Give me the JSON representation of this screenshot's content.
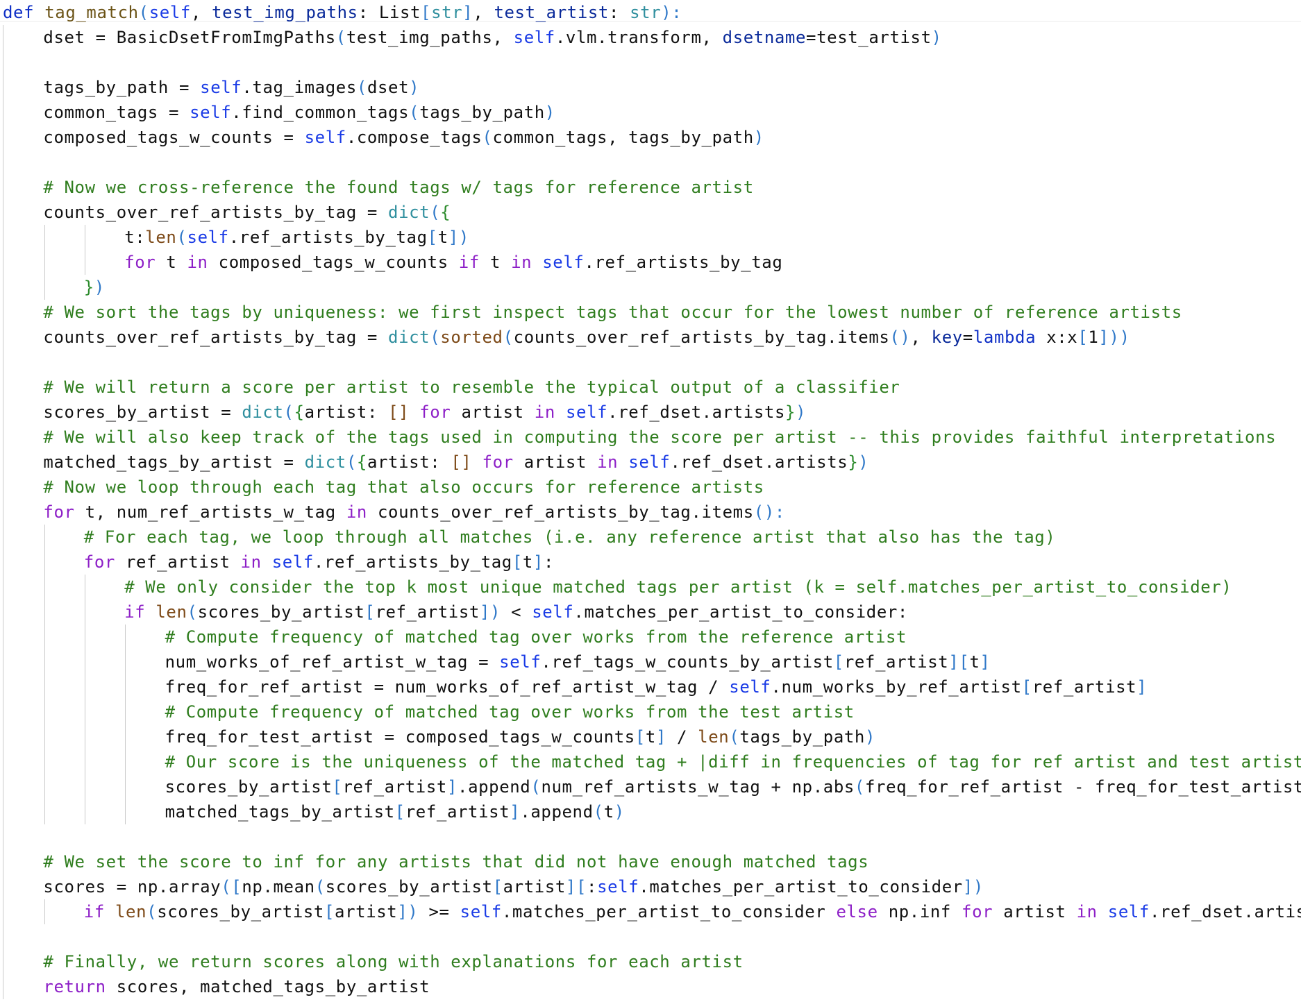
{
  "editor": {
    "language": "python",
    "colors": {
      "background": "#ffffff",
      "default": "#111111",
      "keyword": "#8d1fc7",
      "def_keyword": "#0f2fc6",
      "function_name": "#6b5316",
      "self": "#1a3be6",
      "builtin": "#7d4a18",
      "type": "#2f8f9e",
      "param": "#0a2a9a",
      "comment": "#2f7d1e",
      "bracket": "#2f78c8",
      "brace": "#2a8a2a"
    },
    "lines": [
      {
        "indent": 0,
        "tokens": [
          [
            "def",
            "def_keyword"
          ],
          [
            " ",
            ""
          ],
          [
            "tag_match",
            "function_name"
          ],
          [
            "(",
            "bracket"
          ],
          [
            "self",
            "self"
          ],
          [
            ", ",
            ""
          ],
          [
            "test_img_paths",
            "param"
          ],
          [
            ": List",
            ""
          ],
          [
            "[",
            "bracket"
          ],
          [
            "str",
            "type"
          ],
          [
            "]",
            "bracket"
          ],
          [
            ", ",
            ""
          ],
          [
            "test_artist",
            "param"
          ],
          [
            ": ",
            ""
          ],
          [
            "str",
            "type"
          ],
          [
            "):",
            "bracket"
          ]
        ]
      },
      {
        "indent": 1,
        "tokens": [
          [
            "dset = BasicDsetFromImgPaths",
            ""
          ],
          [
            "(",
            "bracket"
          ],
          [
            "test_img_paths, ",
            ""
          ],
          [
            "self",
            "self"
          ],
          [
            ".vlm.transform, ",
            ""
          ],
          [
            "dsetname",
            "param"
          ],
          [
            "=test_artist",
            ""
          ],
          [
            ")",
            "bracket"
          ]
        ]
      },
      {
        "indent": 1,
        "tokens": []
      },
      {
        "indent": 1,
        "tokens": [
          [
            "tags_by_path = ",
            ""
          ],
          [
            "self",
            "self"
          ],
          [
            ".tag_images",
            ""
          ],
          [
            "(",
            "bracket"
          ],
          [
            "dset",
            ""
          ],
          [
            ")",
            "bracket"
          ]
        ]
      },
      {
        "indent": 1,
        "tokens": [
          [
            "common_tags = ",
            ""
          ],
          [
            "self",
            "self"
          ],
          [
            ".find_common_tags",
            ""
          ],
          [
            "(",
            "bracket"
          ],
          [
            "tags_by_path",
            ""
          ],
          [
            ")",
            "bracket"
          ]
        ]
      },
      {
        "indent": 1,
        "tokens": [
          [
            "composed_tags_w_counts = ",
            ""
          ],
          [
            "self",
            "self"
          ],
          [
            ".compose_tags",
            ""
          ],
          [
            "(",
            "bracket"
          ],
          [
            "common_tags, tags_by_path",
            ""
          ],
          [
            ")",
            "bracket"
          ]
        ]
      },
      {
        "indent": 1,
        "tokens": []
      },
      {
        "indent": 1,
        "tokens": [
          [
            "# Now we cross-reference the found tags w/ tags for reference artist",
            "comment"
          ]
        ]
      },
      {
        "indent": 1,
        "tokens": [
          [
            "counts_over_ref_artists_by_tag = ",
            ""
          ],
          [
            "dict",
            "type"
          ],
          [
            "(",
            "bracket"
          ],
          [
            "{",
            "brace"
          ]
        ]
      },
      {
        "indent": 3,
        "tokens": [
          [
            "t:",
            ""
          ],
          [
            "len",
            "builtin"
          ],
          [
            "(",
            "bracket"
          ],
          [
            "self",
            "self"
          ],
          [
            ".ref_artists_by_tag",
            ""
          ],
          [
            "[",
            "bracket"
          ],
          [
            "t",
            ""
          ],
          [
            "]",
            "bracket"
          ],
          [
            ")",
            "bracket"
          ]
        ]
      },
      {
        "indent": 3,
        "tokens": [
          [
            "for",
            "keyword"
          ],
          [
            " t ",
            ""
          ],
          [
            "in",
            "keyword"
          ],
          [
            " composed_tags_w_counts ",
            ""
          ],
          [
            "if",
            "keyword"
          ],
          [
            " t ",
            ""
          ],
          [
            "in",
            "keyword"
          ],
          [
            " ",
            ""
          ],
          [
            "self",
            "self"
          ],
          [
            ".ref_artists_by_tag",
            ""
          ]
        ]
      },
      {
        "indent": 2,
        "tokens": [
          [
            "}",
            "brace"
          ],
          [
            ")",
            "bracket"
          ]
        ]
      },
      {
        "indent": 1,
        "tokens": [
          [
            "# We sort the tags by uniqueness: we first inspect tags that occur for the lowest number of reference artists",
            "comment"
          ]
        ]
      },
      {
        "indent": 1,
        "tokens": [
          [
            "counts_over_ref_artists_by_tag = ",
            ""
          ],
          [
            "dict",
            "type"
          ],
          [
            "(",
            "bracket"
          ],
          [
            "sorted",
            "builtin"
          ],
          [
            "(",
            "bracket"
          ],
          [
            "counts_over_ref_artists_by_tag.items",
            ""
          ],
          [
            "()",
            "bracket"
          ],
          [
            ", ",
            ""
          ],
          [
            "key",
            "param"
          ],
          [
            "=",
            ""
          ],
          [
            "lambda",
            "def_keyword"
          ],
          [
            " x:x",
            ""
          ],
          [
            "[",
            "bracket"
          ],
          [
            "1",
            ""
          ],
          [
            "]))",
            "bracket"
          ]
        ]
      },
      {
        "indent": 1,
        "tokens": []
      },
      {
        "indent": 1,
        "tokens": [
          [
            "# We will return a score per artist to resemble the typical output of a classifier",
            "comment"
          ]
        ]
      },
      {
        "indent": 1,
        "tokens": [
          [
            "scores_by_artist = ",
            ""
          ],
          [
            "dict",
            "type"
          ],
          [
            "(",
            "bracket"
          ],
          [
            "{",
            "brace"
          ],
          [
            "artist: ",
            ""
          ],
          [
            "[]",
            "builtin"
          ],
          [
            " ",
            ""
          ],
          [
            "for",
            "keyword"
          ],
          [
            " artist ",
            ""
          ],
          [
            "in",
            "keyword"
          ],
          [
            " ",
            ""
          ],
          [
            "self",
            "self"
          ],
          [
            ".ref_dset.artists",
            ""
          ],
          [
            "}",
            "brace"
          ],
          [
            ")",
            "bracket"
          ]
        ]
      },
      {
        "indent": 1,
        "tokens": [
          [
            "# We will also keep track of the tags used in computing the score per artist -- this provides faithful interpretations",
            "comment"
          ]
        ]
      },
      {
        "indent": 1,
        "tokens": [
          [
            "matched_tags_by_artist = ",
            ""
          ],
          [
            "dict",
            "type"
          ],
          [
            "(",
            "bracket"
          ],
          [
            "{",
            "brace"
          ],
          [
            "artist: ",
            ""
          ],
          [
            "[]",
            "builtin"
          ],
          [
            " ",
            ""
          ],
          [
            "for",
            "keyword"
          ],
          [
            " artist ",
            ""
          ],
          [
            "in",
            "keyword"
          ],
          [
            " ",
            ""
          ],
          [
            "self",
            "self"
          ],
          [
            ".ref_dset.artists",
            ""
          ],
          [
            "}",
            "brace"
          ],
          [
            ")",
            "bracket"
          ]
        ]
      },
      {
        "indent": 1,
        "tokens": [
          [
            "# Now we loop through each tag that also occurs for reference artists",
            "comment"
          ]
        ]
      },
      {
        "indent": 1,
        "tokens": [
          [
            "for",
            "keyword"
          ],
          [
            " t, num_ref_artists_w_tag ",
            ""
          ],
          [
            "in",
            "keyword"
          ],
          [
            " counts_over_ref_artists_by_tag.items",
            ""
          ],
          [
            "():",
            "bracket"
          ]
        ]
      },
      {
        "indent": 2,
        "tokens": [
          [
            "# For each tag, we loop through all matches (i.e. any reference artist that also has the tag)",
            "comment"
          ]
        ]
      },
      {
        "indent": 2,
        "tokens": [
          [
            "for",
            "keyword"
          ],
          [
            " ref_artist ",
            ""
          ],
          [
            "in",
            "keyword"
          ],
          [
            " ",
            ""
          ],
          [
            "self",
            "self"
          ],
          [
            ".ref_artists_by_tag",
            ""
          ],
          [
            "[",
            "bracket"
          ],
          [
            "t",
            ""
          ],
          [
            "]",
            "bracket"
          ],
          [
            ":",
            ""
          ]
        ]
      },
      {
        "indent": 3,
        "tokens": [
          [
            "# We only consider the top k most unique matched tags per artist (k = self.matches_per_artist_to_consider)",
            "comment"
          ]
        ]
      },
      {
        "indent": 3,
        "tokens": [
          [
            "if",
            "keyword"
          ],
          [
            " ",
            ""
          ],
          [
            "len",
            "builtin"
          ],
          [
            "(",
            "bracket"
          ],
          [
            "scores_by_artist",
            ""
          ],
          [
            "[",
            "bracket"
          ],
          [
            "ref_artist",
            ""
          ],
          [
            "])",
            "bracket"
          ],
          [
            " < ",
            ""
          ],
          [
            "self",
            "self"
          ],
          [
            ".matches_per_artist_to_consider:",
            ""
          ]
        ]
      },
      {
        "indent": 4,
        "tokens": [
          [
            "# Compute frequency of matched tag over works from the reference artist",
            "comment"
          ]
        ]
      },
      {
        "indent": 4,
        "tokens": [
          [
            "num_works_of_ref_artist_w_tag = ",
            ""
          ],
          [
            "self",
            "self"
          ],
          [
            ".ref_tags_w_counts_by_artist",
            ""
          ],
          [
            "[",
            "bracket"
          ],
          [
            "ref_artist",
            ""
          ],
          [
            "][",
            "bracket"
          ],
          [
            "t",
            ""
          ],
          [
            "]",
            "bracket"
          ]
        ]
      },
      {
        "indent": 4,
        "tokens": [
          [
            "freq_for_ref_artist = num_works_of_ref_artist_w_tag / ",
            ""
          ],
          [
            "self",
            "self"
          ],
          [
            ".num_works_by_ref_artist",
            ""
          ],
          [
            "[",
            "bracket"
          ],
          [
            "ref_artist",
            ""
          ],
          [
            "]",
            "bracket"
          ]
        ]
      },
      {
        "indent": 4,
        "tokens": [
          [
            "# Compute frequency of matched tag over works from the test artist",
            "comment"
          ]
        ]
      },
      {
        "indent": 4,
        "tokens": [
          [
            "freq_for_test_artist = composed_tags_w_counts",
            ""
          ],
          [
            "[",
            "bracket"
          ],
          [
            "t",
            ""
          ],
          [
            "]",
            "bracket"
          ],
          [
            " / ",
            ""
          ],
          [
            "len",
            "builtin"
          ],
          [
            "(",
            "bracket"
          ],
          [
            "tags_by_path",
            ""
          ],
          [
            ")",
            "bracket"
          ]
        ]
      },
      {
        "indent": 4,
        "tokens": [
          [
            "# Our score is the uniqueness of the matched tag + |diff in frequencies of tag for ref artist and test artist|",
            "comment"
          ]
        ]
      },
      {
        "indent": 4,
        "tokens": [
          [
            "scores_by_artist",
            ""
          ],
          [
            "[",
            "bracket"
          ],
          [
            "ref_artist",
            ""
          ],
          [
            "]",
            "bracket"
          ],
          [
            ".append",
            ""
          ],
          [
            "(",
            "bracket"
          ],
          [
            "num_ref_artists_w_tag + np.abs",
            ""
          ],
          [
            "(",
            "bracket"
          ],
          [
            "freq_for_ref_artist - freq_for_test_artist",
            ""
          ],
          [
            "))",
            "bracket"
          ]
        ]
      },
      {
        "indent": 4,
        "tokens": [
          [
            "matched_tags_by_artist",
            ""
          ],
          [
            "[",
            "bracket"
          ],
          [
            "ref_artist",
            ""
          ],
          [
            "]",
            "bracket"
          ],
          [
            ".append",
            ""
          ],
          [
            "(",
            "bracket"
          ],
          [
            "t",
            ""
          ],
          [
            ")",
            "bracket"
          ]
        ]
      },
      {
        "indent": 1,
        "tokens": []
      },
      {
        "indent": 1,
        "tokens": [
          [
            "# We set the score to inf for any artists that did not have enough matched tags",
            "comment"
          ]
        ]
      },
      {
        "indent": 1,
        "tokens": [
          [
            "scores = np.array",
            ""
          ],
          [
            "([",
            "bracket"
          ],
          [
            "np.mean",
            ""
          ],
          [
            "(",
            "bracket"
          ],
          [
            "scores_by_artist",
            ""
          ],
          [
            "[",
            "bracket"
          ],
          [
            "artist",
            ""
          ],
          [
            "][",
            "bracket"
          ],
          [
            ":",
            ""
          ],
          [
            "self",
            "self"
          ],
          [
            ".matches_per_artist_to_consider",
            ""
          ],
          [
            "])",
            "bracket"
          ]
        ]
      },
      {
        "indent": 2,
        "tokens": [
          [
            "if",
            "keyword"
          ],
          [
            " ",
            ""
          ],
          [
            "len",
            "builtin"
          ],
          [
            "(",
            "bracket"
          ],
          [
            "scores_by_artist",
            ""
          ],
          [
            "[",
            "bracket"
          ],
          [
            "artist",
            ""
          ],
          [
            "])",
            "bracket"
          ],
          [
            " >= ",
            ""
          ],
          [
            "self",
            "self"
          ],
          [
            ".matches_per_artist_to_consider ",
            ""
          ],
          [
            "else",
            "keyword"
          ],
          [
            " np.inf ",
            ""
          ],
          [
            "for",
            "keyword"
          ],
          [
            " artist ",
            ""
          ],
          [
            "in",
            "keyword"
          ],
          [
            " ",
            ""
          ],
          [
            "self",
            "self"
          ],
          [
            ".ref_dset.artists",
            ""
          ],
          [
            "])",
            "bracket"
          ]
        ]
      },
      {
        "indent": 1,
        "tokens": []
      },
      {
        "indent": 1,
        "tokens": [
          [
            "# Finally, we return scores along with explanations for each artist",
            "comment"
          ]
        ]
      },
      {
        "indent": 1,
        "tokens": [
          [
            "return",
            "keyword"
          ],
          [
            " scores, matched_tags_by_artist",
            ""
          ]
        ]
      }
    ]
  }
}
